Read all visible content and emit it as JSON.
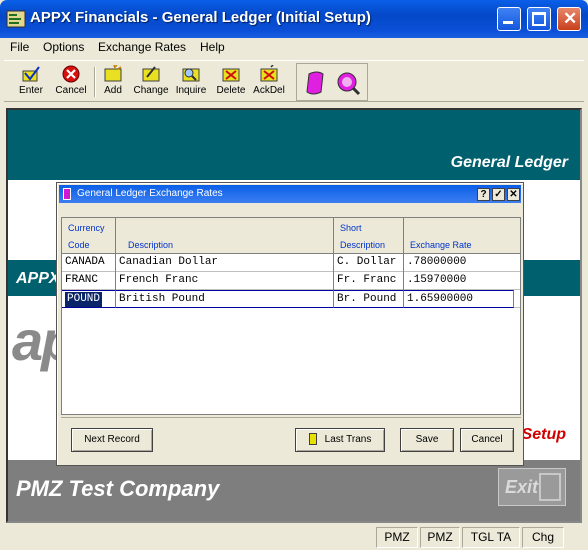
{
  "window": {
    "title": "APPX Financials - General Ledger (Initial Setup)"
  },
  "menu": [
    "File",
    "Options",
    "Exchange Rates",
    "Help"
  ],
  "toolbar": {
    "enter": "Enter",
    "cancel": "Cancel",
    "add": "Add",
    "change": "Change",
    "inquire": "Inquire",
    "delete": "Delete",
    "ackdel": "AckDel"
  },
  "background": {
    "general_ledger": "General Ledger",
    "appx": "APPX",
    "logo": "ap",
    "setup": "Setup",
    "company": "PMZ Test Company",
    "exit": "Exit"
  },
  "dialog": {
    "title": "General Ledger Exchange Rates",
    "columns": {
      "code_line1": "Currency",
      "code_line2": "Code",
      "desc": "Description",
      "short_line1": "Short",
      "short_line2": "Description",
      "rate": "Exchange Rate"
    },
    "rows": [
      {
        "code": "CANADA",
        "desc": "Canadian Dollar",
        "short": "C. Dollar",
        "rate": ".78000000"
      },
      {
        "code": "FRANC",
        "desc": "French Franc",
        "short": "Fr. Franc",
        "rate": ".15970000"
      },
      {
        "code": "POUND",
        "desc": "British Pound",
        "short": "Br. Pound",
        "rate": "1.65900000"
      }
    ],
    "buttons": {
      "next_record": "Next Record",
      "last_trans": "Last Trans",
      "save": "Save",
      "cancel": "Cancel"
    }
  },
  "status": [
    "PMZ",
    "PMZ",
    "TGL TA",
    "Chg"
  ],
  "colors": {
    "titlebar": "#0a5fe8",
    "teal": "#00606e",
    "setup_red": "#d00000"
  }
}
